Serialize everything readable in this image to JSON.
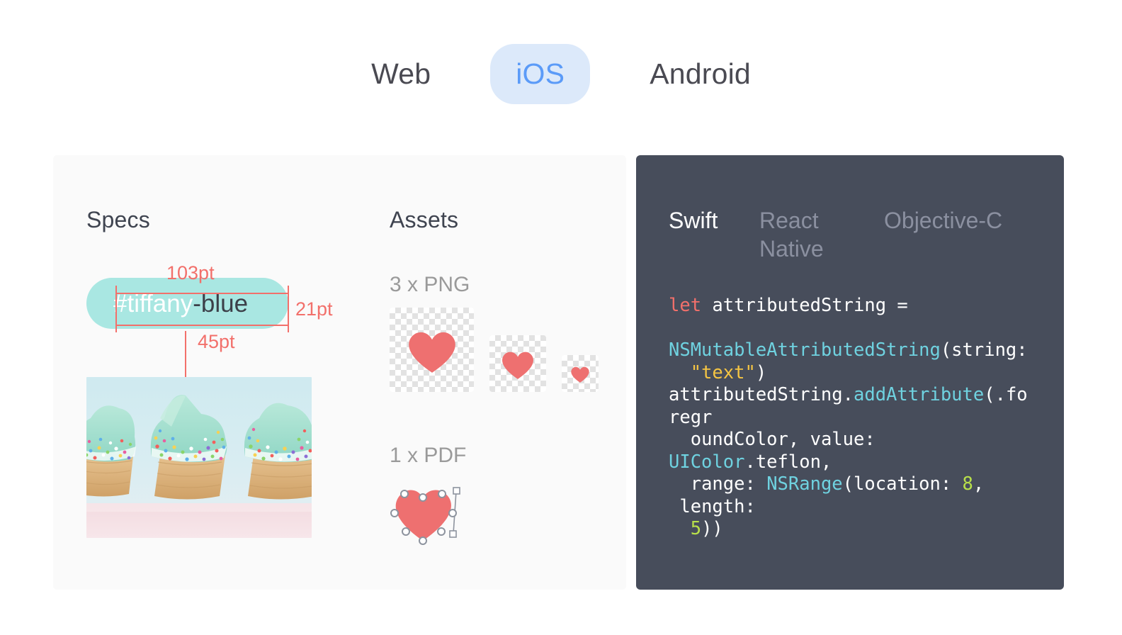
{
  "platform_tabs": [
    {
      "label": "Web",
      "active": false
    },
    {
      "label": "iOS",
      "active": true
    },
    {
      "label": "Android",
      "active": false
    }
  ],
  "specs": {
    "title": "Specs",
    "pill": {
      "text_prefix": "#tiffany",
      "text_suffix": "-blue",
      "fill_color": "#a9e7e2",
      "prefix_color": "#ffffff",
      "suffix_color": "#3c4049"
    },
    "measurements": {
      "width": "103pt",
      "height": "21pt",
      "spacing": "45pt",
      "color": "#f2706b"
    },
    "preview_image_alt": "Three cupcakes with mint frosting and rainbow sprinkles"
  },
  "assets": {
    "title": "Assets",
    "groups": [
      {
        "label": "3 x PNG",
        "type": "png",
        "count": 3
      },
      {
        "label": "1 x PDF",
        "type": "pdf",
        "count": 1
      }
    ],
    "icon_color": "#ee7070",
    "checker_color": "#e2e2e2"
  },
  "code": {
    "tabs": [
      {
        "label": "Swift",
        "active": true
      },
      {
        "label": "React Native",
        "active": false
      },
      {
        "label": "Objective-C",
        "active": false
      }
    ],
    "language": "Swift",
    "panel_color": "#474d5b",
    "snippet_plain": "let attributedString =\n\nNSMutableAttributedString(string:\n  \"text\")\nattributedString.addAttribute(.foregr\n  oundColor, value:\nUIColor.teflon,\n  range: NSRange(location: 8, length:\n  5))",
    "tokens": [
      {
        "t": "let",
        "c": "k-key"
      },
      {
        "t": " attributedString =\n\n",
        "c": ""
      },
      {
        "t": "NSMutableAttributedString",
        "c": "k-type"
      },
      {
        "t": "(string:\n  ",
        "c": ""
      },
      {
        "t": "\"text\"",
        "c": "k-str"
      },
      {
        "t": ")\nattributedString.",
        "c": ""
      },
      {
        "t": "addAttribute",
        "c": "k-fn"
      },
      {
        "t": "(.foregr\n  oundColor, value:\n",
        "c": ""
      },
      {
        "t": "UIColor",
        "c": "k-type"
      },
      {
        "t": ".teflon,\n  range: ",
        "c": ""
      },
      {
        "t": "NSRange",
        "c": "k-type"
      },
      {
        "t": "(location: ",
        "c": ""
      },
      {
        "t": "8",
        "c": "k-num"
      },
      {
        "t": ",\n length:\n  ",
        "c": ""
      },
      {
        "t": "5",
        "c": "k-num"
      },
      {
        "t": "))",
        "c": ""
      }
    ]
  }
}
